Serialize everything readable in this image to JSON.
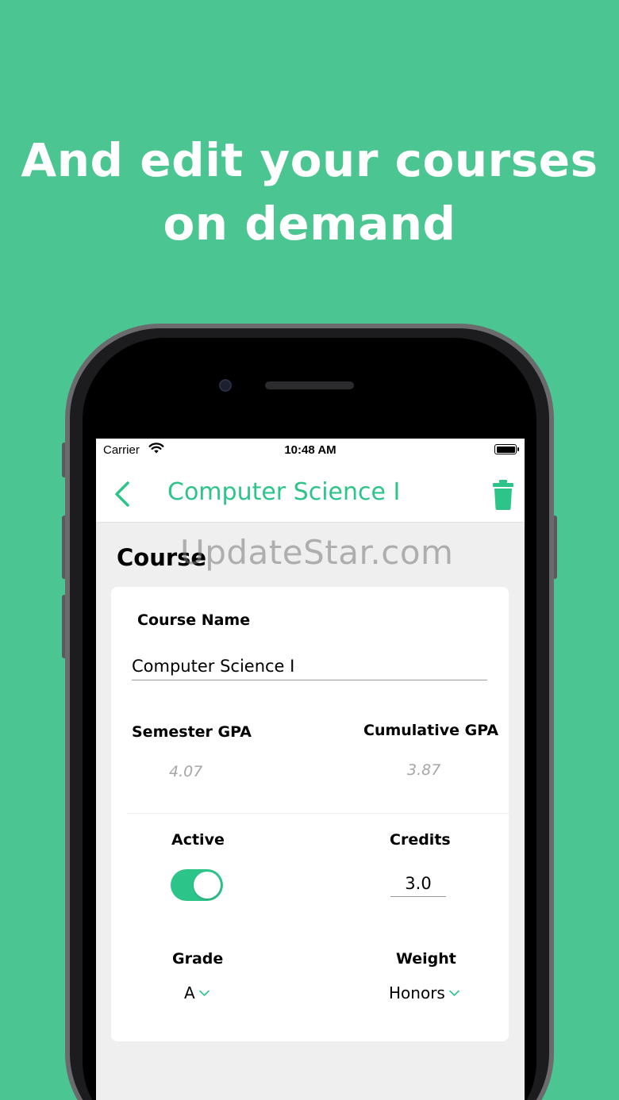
{
  "headline": {
    "line1": "And edit your courses",
    "line2": "on demand"
  },
  "status_bar": {
    "carrier": "Carrier",
    "time": "10:48 AM"
  },
  "nav": {
    "title": "Computer Science I",
    "back_icon": "chevron-left-icon",
    "delete_icon": "trash-icon"
  },
  "section": {
    "title": "Course"
  },
  "watermark": "UpdateStar.com",
  "form": {
    "course_name_label": "Course Name",
    "course_name_value": "Computer Science I",
    "semester_gpa_label": "Semester GPA",
    "semester_gpa_value": "4.07",
    "cumulative_gpa_label": "Cumulative GPA",
    "cumulative_gpa_value": "3.87",
    "active_label": "Active",
    "active_value": true,
    "credits_label": "Credits",
    "credits_value": "3.0",
    "grade_label": "Grade",
    "grade_value": "A",
    "weight_label": "Weight",
    "weight_value": "Honors"
  },
  "colors": {
    "background": "#4BC591",
    "accent": "#2DC48A",
    "screen_bg": "#EFEFEF"
  }
}
